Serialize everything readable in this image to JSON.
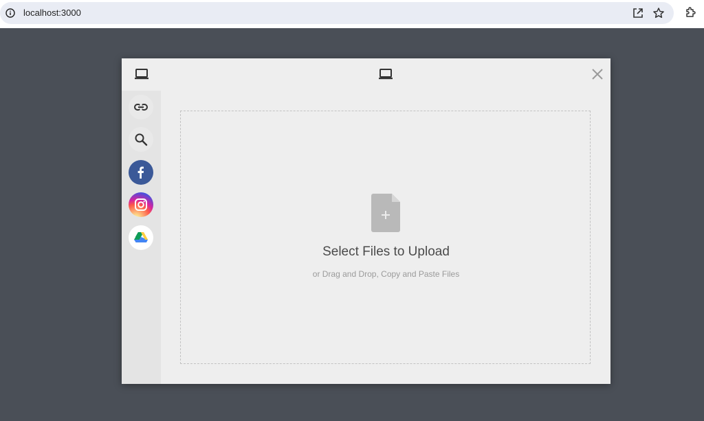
{
  "browser": {
    "url": "localhost:3000",
    "icons": [
      "info-icon",
      "open-in-new-icon",
      "star-icon",
      "extensions-icon"
    ]
  },
  "modal": {
    "header_icons": [
      "laptop-icon",
      "laptop-icon",
      "close-icon"
    ],
    "sources": [
      {
        "name": "link",
        "icon": "link-icon"
      },
      {
        "name": "search",
        "icon": "search-icon"
      },
      {
        "name": "facebook",
        "icon": "facebook-icon",
        "color": "#3b5998"
      },
      {
        "name": "instagram",
        "icon": "instagram-icon"
      },
      {
        "name": "google-drive",
        "icon": "google-drive-icon"
      }
    ],
    "drop_zone": {
      "title": "Select Files to Upload",
      "subtitle": "or Drag and Drop, Copy and Paste Files"
    }
  },
  "colors": {
    "backdrop": "#4a4f57",
    "modal_bg": "#eeeeee",
    "sidebar_bg": "#e4e4e4",
    "file_icon": "#b9b9b9"
  }
}
